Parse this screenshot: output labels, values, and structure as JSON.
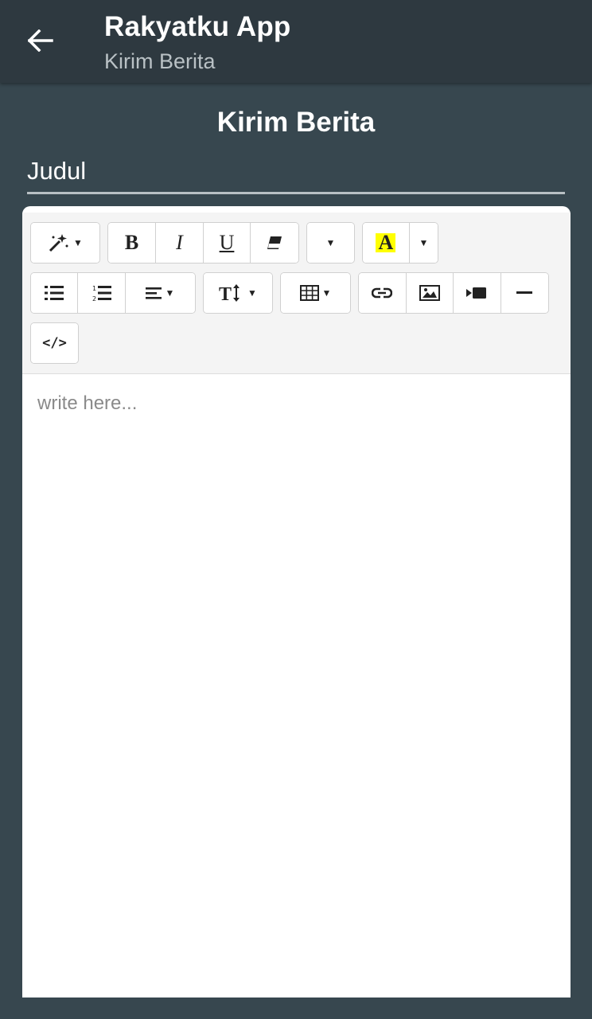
{
  "appbar": {
    "title": "Rakyatku App",
    "subtitle": "Kirim Berita",
    "back_icon": "arrow-left-icon"
  },
  "page": {
    "title": "Kirim Berita"
  },
  "form": {
    "title_placeholder": "Judul",
    "editor_placeholder": "write here..."
  },
  "toolbar": {
    "bold": "B",
    "italic": "I",
    "underline": "U",
    "color_letter": "A",
    "code": "</>",
    "icons": [
      "magic-wand-icon",
      "bold-icon",
      "italic-icon",
      "underline-icon",
      "eraser-icon",
      "font-dropdown-icon",
      "text-color-icon",
      "unordered-list-icon",
      "ordered-list-icon",
      "align-icon",
      "text-height-icon",
      "table-icon",
      "link-icon",
      "image-icon",
      "video-icon",
      "horizontal-rule-icon",
      "code-view-icon"
    ],
    "highlight_color": "#ffff00"
  },
  "colors": {
    "background": "#37474f",
    "appbar": "#2e3940"
  }
}
